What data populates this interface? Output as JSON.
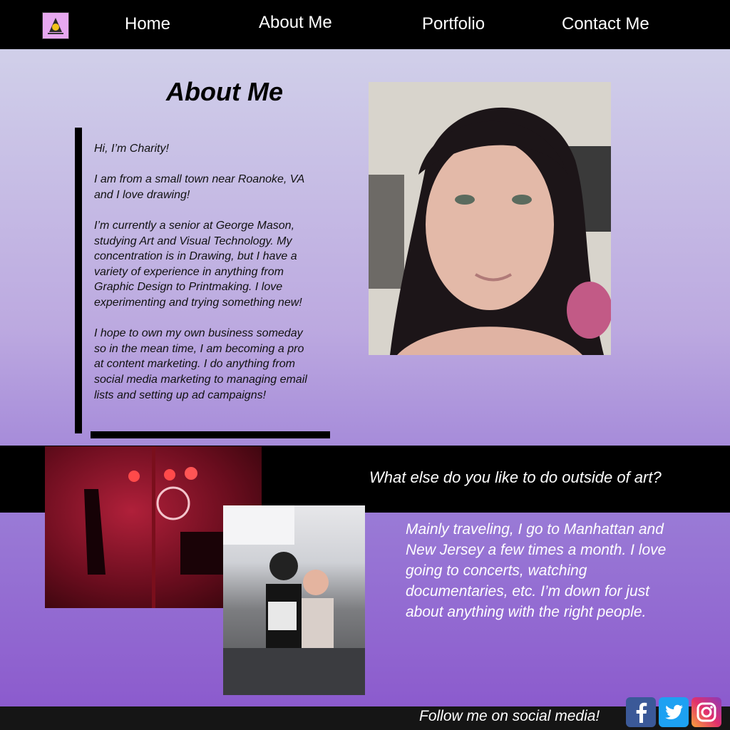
{
  "nav": {
    "home": "Home",
    "about": "About Me",
    "portfolio": "Portfolio",
    "contact": "Contact Me"
  },
  "about": {
    "title": "About Me",
    "bio": [
      "Hi, I’m Charity!",
      "I am from a small town near Roanoke, VA and I love drawing!",
      "I’m currently a senior at George Mason, studying Art and Visual Technology. My concentration is in Drawing, but I have a variety of experience in anything from Graphic Design to Printmaking. I love experimenting and trying something new!",
      "I hope to own my own business someday so in the mean time, I am becoming a pro at content marketing. I do anything from social media marketing to managing email lists and setting up ad campaigns!"
    ]
  },
  "hobbies": {
    "question": "What else do you like to do outside of art?",
    "answer": "Mainly traveling, I go to Manhattan and New Jersey a few times a month. I love going to concerts, watching documentaries, etc. I’m down for just about anything with the right people."
  },
  "footer": {
    "follow": "Follow me on social media!",
    "social_icons": [
      "facebook-icon",
      "twitter-icon",
      "instagram-icon"
    ]
  },
  "colors": {
    "nav_bg": "#000000",
    "facebook": "#3b5998",
    "twitter": "#1da1f2",
    "band": "#000000"
  }
}
